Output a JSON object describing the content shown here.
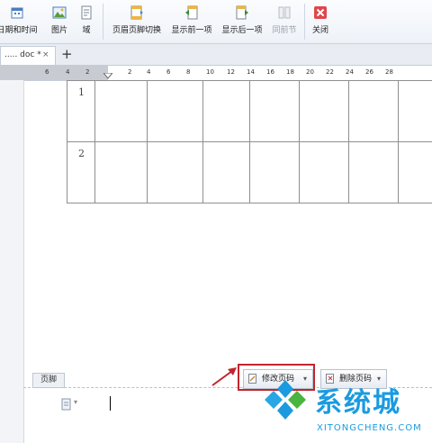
{
  "toolbar": {
    "items": [
      {
        "label": "日期和时间"
      },
      {
        "label": "图片"
      },
      {
        "label": "域"
      },
      {
        "label": "页眉页脚切换"
      },
      {
        "label": "显示前一项"
      },
      {
        "label": "显示后一项"
      },
      {
        "label": "同前节",
        "disabled": true
      },
      {
        "label": "关闭"
      }
    ]
  },
  "tabs": {
    "doc": "..... doc *",
    "close": "×",
    "new": "+"
  },
  "ruler": {
    "ticks": [
      "6",
      "4",
      "2",
      "2",
      "4",
      "6",
      "8",
      "10",
      "12",
      "14",
      "16",
      "18",
      "20",
      "22",
      "24",
      "26",
      "28"
    ]
  },
  "table": {
    "rows": [
      "1",
      "2"
    ]
  },
  "footer": {
    "label": "页脚",
    "modify_page_number": "修改页码",
    "delete_page_number": "删除页码",
    "dropdown_arrow": "▾",
    "small_arrow": "▾"
  },
  "watermark": {
    "title": "系统城",
    "url": "XITONGCHENG.COM"
  },
  "colors": {
    "highlight_box": "#c0262d",
    "arrow": "#c0262d",
    "watermark_blue": "#1a9be0",
    "close_icon": "#e0464a"
  }
}
